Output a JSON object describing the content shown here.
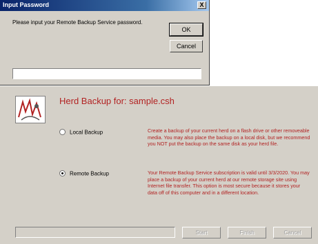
{
  "password_dialog": {
    "title": "Input Password",
    "close_glyph": "X",
    "prompt": "Please input your Remote Backup Service password.",
    "ok_label": "OK",
    "cancel_label": "Cancel",
    "password_value": ""
  },
  "wizard": {
    "title": "Herd Backup for: sample.csh",
    "icon": "herd-logo-icon",
    "options": [
      {
        "label": "Local Backup",
        "selected": false,
        "description": "Create a backup of your current herd on a flash drive or other removeable media. You may also place the backup on a local disk, but we recommend you NOT put the backup on the same disk as your herd file."
      },
      {
        "label": "Remote Backup",
        "selected": true,
        "description": "Your Remote Backup Service subscription is valid until 3/3/2020. You may place a backup of your current herd at our remote storage site using Internet file transfer. This option is most secure because it stores your data off of this computer and in a different location."
      }
    ],
    "start_label": "Start",
    "finish_label": "Finish",
    "cancel_label": "Cancel"
  },
  "colors": {
    "accent_text": "#b22222",
    "titlebar": "#0a246a",
    "window_face": "#d4d0c8"
  }
}
